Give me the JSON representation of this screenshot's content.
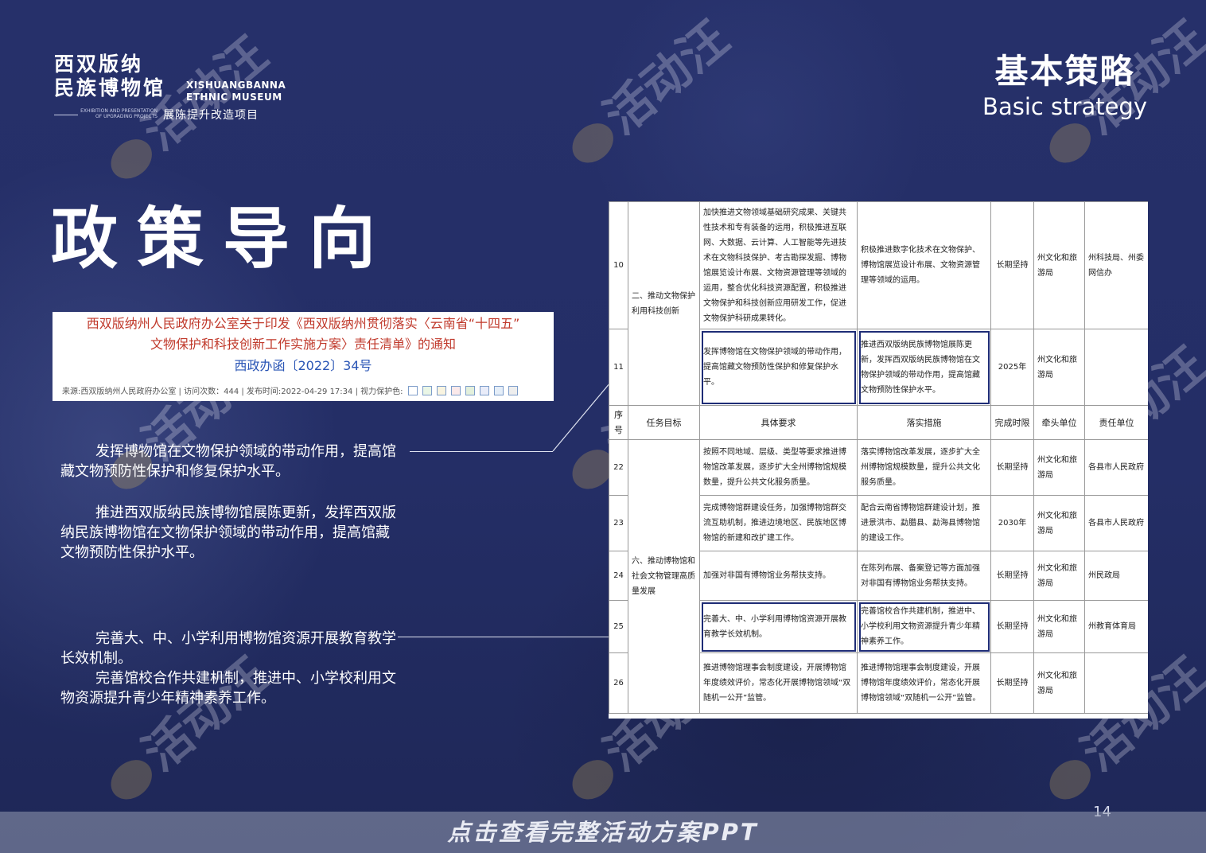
{
  "header": {
    "logo_cn_line1": "西双版纳",
    "logo_cn_line2": "民族博物馆",
    "logo_en": "XISHUANGBANNA ETHNIC MUSEUM",
    "logo_small": "EXHIBITION AND PRESENTATION OF UPGRADING PROJECTS",
    "logo_project": "展陈提升改造项目",
    "section_cn": "基本策略",
    "section_en": "Basic strategy"
  },
  "title": "政策导向",
  "notice": {
    "line1": "西双版纳州人民政府办公室关于印发《西双版纳州贯彻落实〈云南省“十四五”",
    "line2": "文物保护和科技创新工作实施方案〉责任清单》的通知",
    "doc_no": "西政办函〔2022〕34号",
    "meta": "来源:西双版纳州人民政府办公室 | 访问次数：444 | 发布时间:2022-04-29 17:34 | 视力保护色:"
  },
  "paragraphs": [
    "发挥博物馆在文物保护领域的带动作用，提高馆藏文物预防性保护和修复保护水平。",
    "推进西双版纳民族博物馆展陈更新，发挥西双版纳民族博物馆在文物保护领域的带动作用，提高馆藏文物预防性保护水平。",
    "完善大、中、小学利用博物馆资源开展教育教学长效机制。",
    "完善馆校合作共建机制，推进中、小学校利用文物资源提升青少年精神素养工作。"
  ],
  "table": {
    "headers": [
      "序号",
      "任务目标",
      "具体要求",
      "落实措施",
      "完成时限",
      "牵头单位",
      "责任单位"
    ],
    "group1": "二、推动文物保护利用科技创新",
    "group2": "六、推动博物馆和社会文物管理高质量发展",
    "rows_top": [
      {
        "no": "10",
        "req": "加快推进文物领域基础研究成果、关键共性技术和专有装备的运用，积极推进互联网、大数据、云计算、人工智能等先进技术在文物科技保护、考古勘探发掘、博物馆展览设计布展、文物资源管理等领域的运用，整合优化科技资源配置，积极推进文物保护和科技创新应用研发工作，促进文物保护科研成果转化。",
        "measure": "积极推进数字化技术在文物保护、博物馆展览设计布展、文物资源管理等领域的运用。",
        "time": "长期坚持",
        "lead": "州文化和旅游局",
        "resp": "州科技局、州委网信办"
      },
      {
        "no": "11",
        "req": "发挥博物馆在文物保护领域的带动作用，提高馆藏文物预防性保护和修复保护水平。",
        "measure": "推进西双版纳民族博物馆展陈更新，发挥西双版纳民族博物馆在文物保护领域的带动作用，提高馆藏文物预防性保护水平。",
        "time": "2025年",
        "lead": "州文化和旅游局",
        "resp": ""
      }
    ],
    "rows_bottom": [
      {
        "no": "22",
        "req": "按照不同地域、层级、类型等要求推进博物馆改革发展，逐步扩大全州博物馆规模数量，提升公共文化服务质量。",
        "measure": "落实博物馆改革发展，逐步扩大全州博物馆规模数量，提升公共文化服务质量。",
        "time": "长期坚持",
        "lead": "州文化和旅游局",
        "resp": "各县市人民政府"
      },
      {
        "no": "23",
        "req": "完成博物馆群建设任务，加强博物馆群交流互助机制，推进边境地区、民族地区博物馆的新建和改扩建工作。",
        "measure": "配合云南省博物馆群建设计划，推进景洪市、勐腊县、勐海县博物馆的建设工作。",
        "time": "2030年",
        "lead": "州文化和旅游局",
        "resp": "各县市人民政府"
      },
      {
        "no": "24",
        "req": "加强对非国有博物馆业务帮扶支持。",
        "measure": "在陈列布展、备案登记等方面加强对非国有博物馆业务帮扶支持。",
        "time": "长期坚持",
        "lead": "州文化和旅游局",
        "resp": "州民政局"
      },
      {
        "no": "25",
        "req": "完善大、中、小学利用博物馆资源开展教育教学长效机制。",
        "measure": "完善馆校合作共建机制，推进中、小学校利用文物资源提升青少年精神素养工作。",
        "time": "长期坚持",
        "lead": "州文化和旅游局",
        "resp": "州教育体育局"
      },
      {
        "no": "26",
        "req": "推进博物馆理事会制度建设，开展博物馆年度绩效评价，常态化开展博物馆领域“双随机一公开”监管。",
        "measure": "推进博物馆理事会制度建设，开展博物馆年度绩效评价，常态化开展博物馆领域“双随机一公开”监管。",
        "time": "长期坚持",
        "lead": "州文化和旅游局",
        "resp": ""
      }
    ]
  },
  "watermark": "活动汪",
  "page_number": "14",
  "bottom_banner": "点击查看完整活动方案PPT"
}
